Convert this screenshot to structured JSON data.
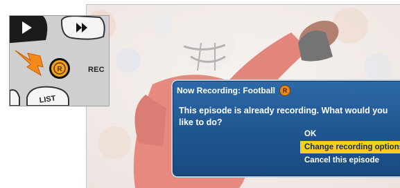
{
  "remote": {
    "rec_label": "REC",
    "rec_button_letter": "R",
    "play_icon": "play-icon",
    "ffwd_icon": "fast-forward-icon",
    "list_label": "LIST",
    "arrow_color": "#f28a1d",
    "rec_button_color": "#f0a21e"
  },
  "dialog": {
    "title": "Now Recording: Football",
    "status_letter": "R",
    "message": "This episode is already recording. What would you like to do?",
    "options": [
      {
        "label": "OK",
        "selected": false
      },
      {
        "label": "Change recording options",
        "selected": true
      },
      {
        "label": "Cancel this episode",
        "selected": false
      }
    ],
    "colors": {
      "panel": "#1f5590",
      "highlight": "#f2d21b",
      "highlight_text": "#1a2a55"
    }
  }
}
